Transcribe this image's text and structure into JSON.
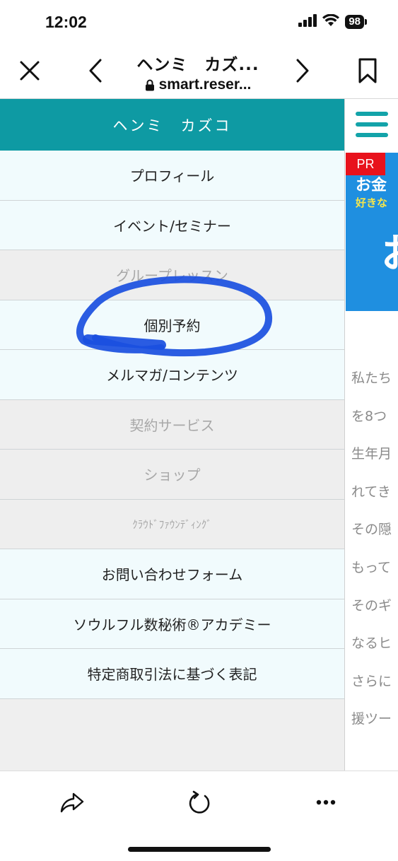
{
  "status_bar": {
    "time": "12:02",
    "battery": "98"
  },
  "browser": {
    "title": "ヘンミ　カズ...",
    "url": "smart.reser...",
    "icons": [
      "close-icon",
      "back-icon",
      "lock-icon",
      "forward-icon",
      "bookmark-icon"
    ]
  },
  "menu": {
    "header": "ヘンミ　カズコ",
    "items": [
      {
        "label": "プロフィール",
        "enabled": true
      },
      {
        "label": "イベント/セミナー",
        "enabled": true
      },
      {
        "label": "グループレッスン",
        "enabled": false
      },
      {
        "label": "個別予約",
        "enabled": true
      },
      {
        "label": "メルマガ/コンテンツ",
        "enabled": true
      },
      {
        "label": "契約サービス",
        "enabled": false
      },
      {
        "label": "ショップ",
        "enabled": false
      },
      {
        "label": "ｸﾗｳﾄﾞﾌｧｳﾝﾃﾞｨﾝｸﾞ",
        "enabled": false
      },
      {
        "label": "お問い合わせフォーム",
        "enabled": true
      },
      {
        "label": "ソウルフル数秘術®アカデミー",
        "enabled": true
      },
      {
        "label": "特定商取引法に基づく表記",
        "enabled": true
      }
    ]
  },
  "page": {
    "banner": {
      "pr": "PR",
      "line1": "お金",
      "line2": "好きな",
      "line3": "お"
    },
    "body_lines": [
      "私たち",
      "を8つ",
      "生年月",
      "れてき",
      "その隠",
      "もって",
      "そのギ",
      "なるヒ",
      "さらに",
      "援ツー"
    ]
  },
  "colors": {
    "accent": "#0e9aa3",
    "hamburger": "#13a3a9",
    "annotation": "#1a4fe0",
    "pr": "#e8121c"
  },
  "toolbar": {
    "icons": [
      "share-icon",
      "reload-icon",
      "more-icon"
    ]
  }
}
